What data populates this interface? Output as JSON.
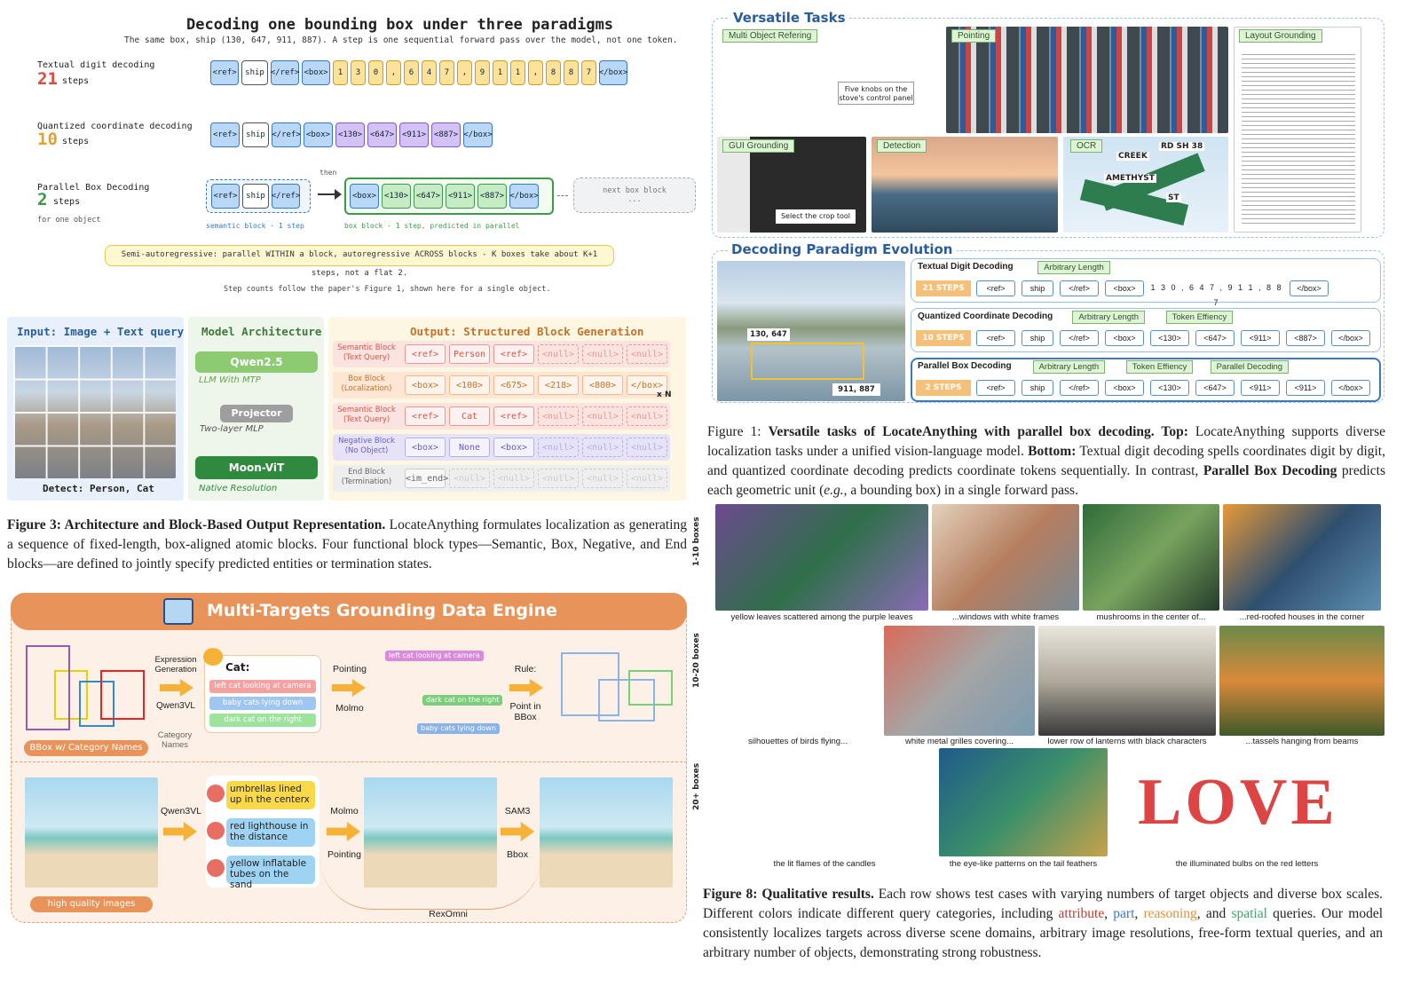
{
  "fig_top_left": {
    "title": "Decoding one bounding box under three paradigms",
    "subtitle": "The same box, ship (130, 647, 911, 887). A step is one sequential forward pass over the model, not one token.",
    "row1": {
      "label": "Textual digit decoding",
      "count": "21",
      "unit": "steps",
      "tokens": [
        "<ref>",
        "ship",
        "</ref>",
        "<box>",
        "1",
        "3",
        "0",
        ",",
        "6",
        "4",
        "7",
        ",",
        "9",
        "1",
        "1",
        ",",
        "8",
        "8",
        "7",
        "</box>"
      ]
    },
    "row2": {
      "label": "Quantized coordinate decoding",
      "count": "10",
      "unit": "steps",
      "tokens": [
        "<ref>",
        "ship",
        "</ref>",
        "<box>",
        "<130>",
        "<647>",
        "<911>",
        "<887>",
        "</box>"
      ]
    },
    "row3": {
      "label": "Parallel Box Decoding",
      "count": "2",
      "unit": "steps",
      "sub": "for one object",
      "sem_tokens": [
        "<ref>",
        "ship",
        "</ref>"
      ],
      "box_tokens": [
        "<box>",
        "<130>",
        "<647>",
        "<911>",
        "<887>",
        "</box>"
      ],
      "then": "then",
      "next": "next box block ...",
      "sem_caption": "semantic block · 1 step",
      "box_caption": "box block · 1 step, predicted in parallel"
    },
    "note": "Semi-autoregressive: parallel WITHIN a block, autoregressive ACROSS blocks - K boxes take about K+1 steps, not a flat 2.",
    "foot": "Step counts follow the paper's Figure 1, shown here for a single object."
  },
  "fig3": {
    "input_title": "Input: Image + Text query",
    "input_caption": "Detect: Person, Cat",
    "arch_title": "Model Architecture",
    "qwen": "Qwen2.5",
    "mtp": "LLM With MTP",
    "projector": "Projector",
    "mlp": "Two-layer MLP",
    "vit": "Moon-ViT",
    "native": "Native Resolution",
    "out_title": "Output: Structured Block Generation",
    "blocks": [
      {
        "name": "Semantic Block (Text Query)",
        "cells": [
          "<ref>",
          "Person",
          "<ref>",
          "<null>",
          "<null>",
          "<null>"
        ]
      },
      {
        "name": "Box Block (Localization)",
        "cells": [
          "<box>",
          "<100>",
          "<675>",
          "<218>",
          "<800>",
          "</box>"
        ]
      },
      {
        "name": "Semantic Block (Text Query)",
        "cells": [
          "<ref>",
          "Cat",
          "<ref>",
          "<null>",
          "<null>",
          "<null>"
        ]
      },
      {
        "name": "Negative Block (No Object)",
        "cells": [
          "<box>",
          "None",
          "<box>",
          "<null>",
          "<null>",
          "<null>"
        ]
      },
      {
        "name": "End Block (Termination)",
        "cells": [
          "<im_end>",
          "<null>",
          "<null>",
          "<null>",
          "<null>",
          "<null>"
        ]
      }
    ],
    "xn": "x N",
    "caption_bold": "Figure 3: Architecture and Block-Based Output Representation.",
    "caption_rest": " LocateAnything formulates localization as generating a sequence of fixed-length, box-aligned atomic blocks. Four functional block types—Semantic, Box, Negative, and End blocks—are defined to jointly specify predicted entities or termination states."
  },
  "engine": {
    "title": "Multi-Targets Grounding Data Engine",
    "expr": "Expression Generation",
    "qwen": "Qwen3VL",
    "cat_names": "Category Names",
    "cat": "Cat:",
    "phrases": [
      "left cat looking at camera",
      "baby cats lying down",
      "dark cat on the right"
    ],
    "pointing": "Pointing",
    "molmo": "Molmo",
    "rule": "Rule:",
    "point_in": "Point in BBox",
    "bbox_label": "BBox w/ Category Names",
    "overlay": [
      "left cat looking at camera",
      "dark cat on the right",
      "baby cats lying down"
    ],
    "qwen2": "Qwen3VL",
    "items": [
      "umbrellas lined up in the centerx",
      "red lighthouse in the distance",
      "yellow inflatable tubes on the sand"
    ],
    "molmo2": "Molmo",
    "pointing2": "Pointing",
    "sam": "SAM3",
    "bbox": "Bbox",
    "hq": "high quality images",
    "rex": "RexOmni"
  },
  "fig1": {
    "versatile": "Versatile Tasks",
    "tasks": [
      "Multi Object Refering",
      "Pointing",
      "Layout Grounding",
      "GUI Grounding",
      "Detection",
      "OCR"
    ],
    "knobs": "Five knobs on the stove's control panel",
    "crop": "Select the crop tool",
    "ocr_words": [
      "CREEK",
      "RD SH 38",
      "AMETHYST",
      "ST"
    ],
    "evo": "Decoding Paradigm Evolution",
    "coord1": "130, 647",
    "coord2": "911, 887",
    "p1": {
      "name": "Textual Digit Decoding",
      "tags": [
        "Arbitrary Length"
      ],
      "steps": "21 STEPS",
      "tokens": [
        "<ref>",
        "ship",
        "</ref>",
        "<box>",
        "1 3 0 , 6 4 7 , 9 1 1 , 8 8 7",
        "</box>"
      ]
    },
    "p2": {
      "name": "Quantized Coordinate Decoding",
      "tags": [
        "Arbitrary Length",
        "Token Effiency"
      ],
      "steps": "10 STEPS",
      "tokens": [
        "<ref>",
        "ship",
        "</ref>",
        "<box>",
        "<130>",
        "<647>",
        "<911>",
        "<887>",
        "</box>"
      ]
    },
    "p3": {
      "name": "Parallel Box Decoding",
      "tags": [
        "Arbitrary Length",
        "Token Effiency",
        "Parallel Decoding"
      ],
      "steps": "2 STEPS",
      "tokens": [
        "<ref>",
        "ship",
        "</ref>",
        "<box>",
        "<130>",
        "<647>",
        "<911>",
        "<911>",
        "</box>"
      ]
    },
    "caption_a": "Figure 1: ",
    "caption_b": "Versatile tasks of LocateAnything with parallel box decoding. Top:",
    "caption_c": " LocateAnything supports diverse localization tasks under a unified vision-language model. ",
    "caption_d": "Bottom:",
    "caption_e": " Textual digit decoding spells coordinates digit by digit, and quantized coordinate decoding predicts coordinate tokens sequentially. In contrast, ",
    "caption_f": "Parallel Box Decoding",
    "caption_g": " predicts each geometric unit (",
    "caption_h": "e.g.",
    "caption_i": ", a bounding box) in a single forward pass."
  },
  "fig8": {
    "rows": [
      "1-10 boxes",
      "10-20 boxes",
      "20+ boxes"
    ],
    "r1": [
      "yellow leaves scattered among the purple leaves",
      "...windows with white frames",
      "mushrooms in the center of...",
      "...red-roofed houses in the corner"
    ],
    "r2": [
      "silhouettes of birds flying...",
      "white metal grilles covering...",
      "lower row of lanterns with black characters",
      "...tassels hanging from beams"
    ],
    "r3": [
      "the lit flames of the candles",
      "the eye-like patterns on the tail feathers",
      "the illuminated bulbs on the red letters"
    ],
    "love": "LOVE",
    "cap_bold": "Figure 8: Qualitative results.",
    "cap1": " Each row shows test cases with varying numbers of target objects and diverse box scales. Different colors indicate different query categories, including ",
    "attr": "attribute",
    "part": "part",
    "reason": "reasoning",
    "and": ", and ",
    "spatial": "spatial",
    "cap2": " queries. Our model consistently localizes targets across diverse scene domains, arbitrary image resolutions, free-form textual queries, and an arbitrary number of objects, demonstrating strong robustness."
  },
  "colors": {
    "attribute": "#c0392b",
    "part": "#3a78c4",
    "reasoning": "#e69138",
    "spatial": "#3fa66a"
  }
}
